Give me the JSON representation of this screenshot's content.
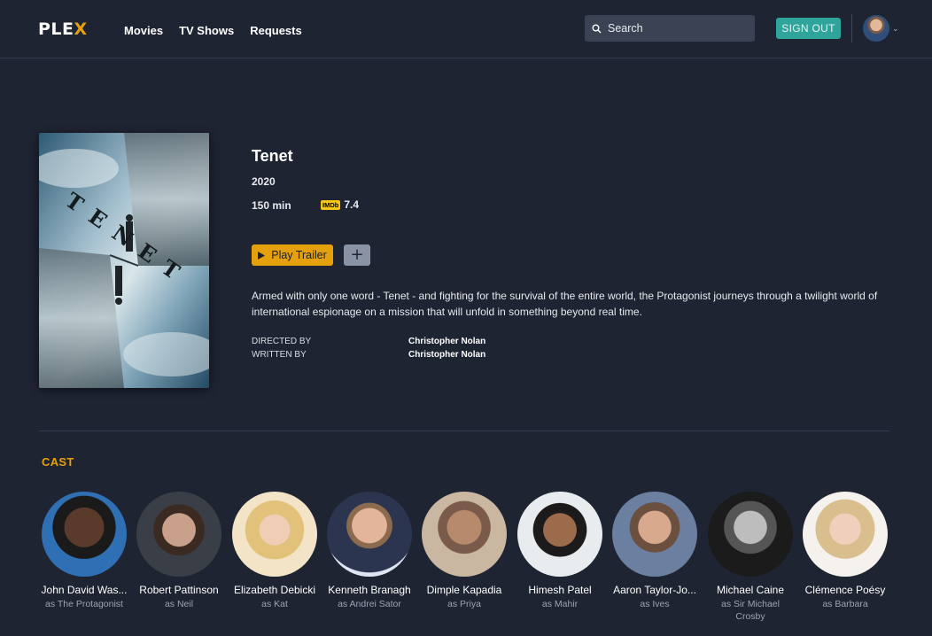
{
  "header": {
    "logo_main": "PLE",
    "logo_accent": "X",
    "nav": [
      "Movies",
      "TV Shows",
      "Requests"
    ],
    "search_placeholder": "Search",
    "signout_label": "SIGN OUT",
    "accent_color": "#e5a00d",
    "signout_color": "#2fa49b"
  },
  "movie": {
    "title": "Tenet",
    "year": "2020",
    "runtime": "150 min",
    "imdb_label": "IMDb",
    "imdb_rating": "7.4",
    "play_trailer_label": "Play Trailer",
    "add_label": "+",
    "overview": "Armed with only one word - Tenet - and fighting for the survival of the entire world, the Protagonist journeys through a twilight world of international espionage on a mission that will unfold in something beyond real time.",
    "poster_text": "TENET",
    "credits": [
      {
        "label": "DIRECTED BY",
        "value": "Christopher Nolan"
      },
      {
        "label": "WRITTEN BY",
        "value": "Christopher Nolan"
      }
    ]
  },
  "cast": {
    "heading": "CAST",
    "members": [
      {
        "name": "John David Was...",
        "role": "as The Protagonist"
      },
      {
        "name": "Robert Pattinson",
        "role": "as Neil"
      },
      {
        "name": "Elizabeth Debicki",
        "role": "as Kat"
      },
      {
        "name": "Kenneth Branagh",
        "role": "as Andrei Sator"
      },
      {
        "name": "Dimple Kapadia",
        "role": "as Priya"
      },
      {
        "name": "Himesh Patel",
        "role": "as Mahir"
      },
      {
        "name": "Aaron Taylor-Jo...",
        "role": "as Ives"
      },
      {
        "name": "Michael Caine",
        "role": "as Sir Michael Crosby"
      },
      {
        "name": "Clémence Poésy",
        "role": "as Barbara"
      }
    ]
  }
}
